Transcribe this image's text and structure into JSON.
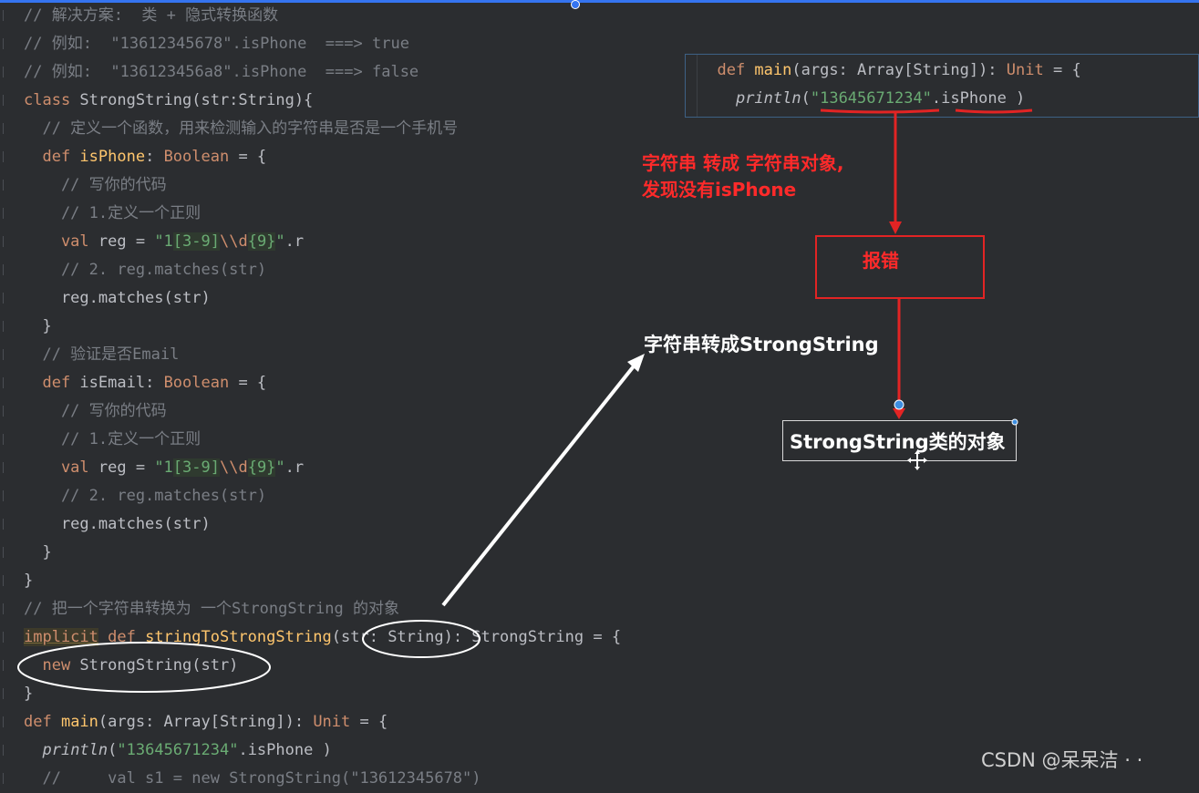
{
  "code_lines": [
    {
      "parts": [
        {
          "t": "// 解决方案:  类 + 隐式转换函数",
          "c": "cm"
        }
      ]
    },
    {
      "parts": [
        {
          "t": "// 例如:  \"13612345678\".isPhone  ===> true",
          "c": "cm"
        }
      ]
    },
    {
      "parts": [
        {
          "t": "// 例如:  \"136123456a8\".isPhone  ===> false",
          "c": "cm"
        }
      ]
    },
    {
      "parts": [
        {
          "t": "class ",
          "c": "kw"
        },
        {
          "t": "StrongString(str:String){",
          "c": "plain"
        }
      ]
    },
    {
      "parts": [
        {
          "t": "  // 定义一个函数，用来检测输入的字符串是否是一个手机号",
          "c": "cm"
        }
      ]
    },
    {
      "parts": [
        {
          "t": "  def ",
          "c": "kw"
        },
        {
          "t": "isPhone",
          "c": "bold"
        },
        {
          "t": ": ",
          "c": "plain"
        },
        {
          "t": "Boolean",
          "c": "kw"
        },
        {
          "t": " = {",
          "c": "plain"
        }
      ]
    },
    {
      "parts": [
        {
          "t": "    // 写你的代码",
          "c": "cm"
        }
      ]
    },
    {
      "parts": [
        {
          "t": "    // 1.定义一个正则",
          "c": "cm"
        }
      ]
    },
    {
      "parts": [
        {
          "t": "    val ",
          "c": "kw"
        },
        {
          "t": "reg = ",
          "c": "plain"
        },
        {
          "t": "\"1",
          "c": "st"
        },
        {
          "t": "[3-9]",
          "c": "rx"
        },
        {
          "t": "\\\\d",
          "c": "esc"
        },
        {
          "t": "{9}",
          "c": "rx"
        },
        {
          "t": "\"",
          "c": "st"
        },
        {
          "t": ".r",
          "c": "plain"
        }
      ]
    },
    {
      "parts": [
        {
          "t": "    // 2. reg.matches(str)",
          "c": "cm"
        }
      ]
    },
    {
      "parts": [
        {
          "t": "    reg.matches(str)",
          "c": "plain"
        }
      ]
    },
    {
      "parts": [
        {
          "t": "  }",
          "c": "plain"
        }
      ]
    },
    {
      "parts": [
        {
          "t": "  // 验证是否Email",
          "c": "cm"
        }
      ]
    },
    {
      "parts": [
        {
          "t": "  def ",
          "c": "kw"
        },
        {
          "t": "isEmail",
          "c": "plain"
        },
        {
          "t": ": ",
          "c": "plain"
        },
        {
          "t": "Boolean",
          "c": "kw"
        },
        {
          "t": " = {",
          "c": "plain"
        }
      ]
    },
    {
      "parts": [
        {
          "t": "    // 写你的代码",
          "c": "cm"
        }
      ]
    },
    {
      "parts": [
        {
          "t": "    // 1.定义一个正则",
          "c": "cm"
        }
      ]
    },
    {
      "parts": [
        {
          "t": "    val ",
          "c": "kw"
        },
        {
          "t": "reg = ",
          "c": "plain"
        },
        {
          "t": "\"1",
          "c": "st"
        },
        {
          "t": "[3-9]",
          "c": "rx"
        },
        {
          "t": "\\\\d",
          "c": "esc"
        },
        {
          "t": "{9}",
          "c": "rx"
        },
        {
          "t": "\"",
          "c": "st"
        },
        {
          "t": ".r",
          "c": "plain"
        }
      ]
    },
    {
      "parts": [
        {
          "t": "    // 2. reg.matches(str)",
          "c": "cm"
        }
      ]
    },
    {
      "parts": [
        {
          "t": "    reg.matches(str)",
          "c": "plain"
        }
      ]
    },
    {
      "parts": [
        {
          "t": "  }",
          "c": "plain"
        }
      ]
    },
    {
      "parts": [
        {
          "t": "}",
          "c": "plain"
        }
      ]
    },
    {
      "parts": [
        {
          "t": "// 把一个字符串转换为 一个StrongString 的对象",
          "c": "cm"
        }
      ]
    },
    {
      "parts": [
        {
          "t": "implicit",
          "c": "impl"
        },
        {
          "t": " def ",
          "c": "kw"
        },
        {
          "t": "stringToStrongString",
          "c": "bold"
        },
        {
          "t": "(str: String): StrongString = {",
          "c": "plain"
        }
      ]
    },
    {
      "parts": [
        {
          "t": "  new ",
          "c": "kw"
        },
        {
          "t": "StrongString(str)",
          "c": "plain"
        }
      ]
    },
    {
      "parts": [
        {
          "t": "}",
          "c": "plain"
        }
      ]
    },
    {
      "parts": [
        {
          "t": "def ",
          "c": "kw"
        },
        {
          "t": "main",
          "c": "bold"
        },
        {
          "t": "(args: Array[String]): ",
          "c": "plain"
        },
        {
          "t": "Unit",
          "c": "kw"
        },
        {
          "t": " = {",
          "c": "plain"
        }
      ]
    },
    {
      "parts": [
        {
          "t": "  ",
          "c": "plain"
        },
        {
          "t": "println",
          "c": "it"
        },
        {
          "t": "(",
          "c": "plain"
        },
        {
          "t": "\"13645671234\"",
          "c": "st"
        },
        {
          "t": ".isPhone )",
          "c": "plain"
        }
      ]
    },
    {
      "parts": [
        {
          "t": "  //     val s1 = new StrongString(\"13612345678\")",
          "c": "cm"
        }
      ]
    }
  ],
  "popup": {
    "lines": [
      {
        "parts": [
          {
            "t": "  def ",
            "c": "kw"
          },
          {
            "t": "main",
            "c": "bold"
          },
          {
            "t": "(args: Array[String]): ",
            "c": "plain"
          },
          {
            "t": "Unit",
            "c": "kw"
          },
          {
            "t": " = {",
            "c": "plain"
          }
        ]
      },
      {
        "parts": [
          {
            "t": "    ",
            "c": "plain"
          },
          {
            "t": "println",
            "c": "it"
          },
          {
            "t": "(",
            "c": "plain"
          },
          {
            "t": "\"13645671234\"",
            "c": "st"
          },
          {
            "t": ".isPhone )",
            "c": "plain"
          }
        ]
      }
    ]
  },
  "annotations": {
    "note_line1": "字符串 转成 字符串对象,",
    "note_line2": "发现没有isPhone",
    "error_box": "报错",
    "convert_label": "字符串转成StrongString",
    "object_box": "StrongString类的对象"
  },
  "watermark": "CSDN @呆呆洁 · ·",
  "colors": {
    "background": "#2b2d30",
    "keyword": "#cf8e6d",
    "comment": "#7a7e85",
    "string": "#6aab73",
    "annotation_red": "#ff2a2a",
    "accent_blue": "#3574f0"
  }
}
